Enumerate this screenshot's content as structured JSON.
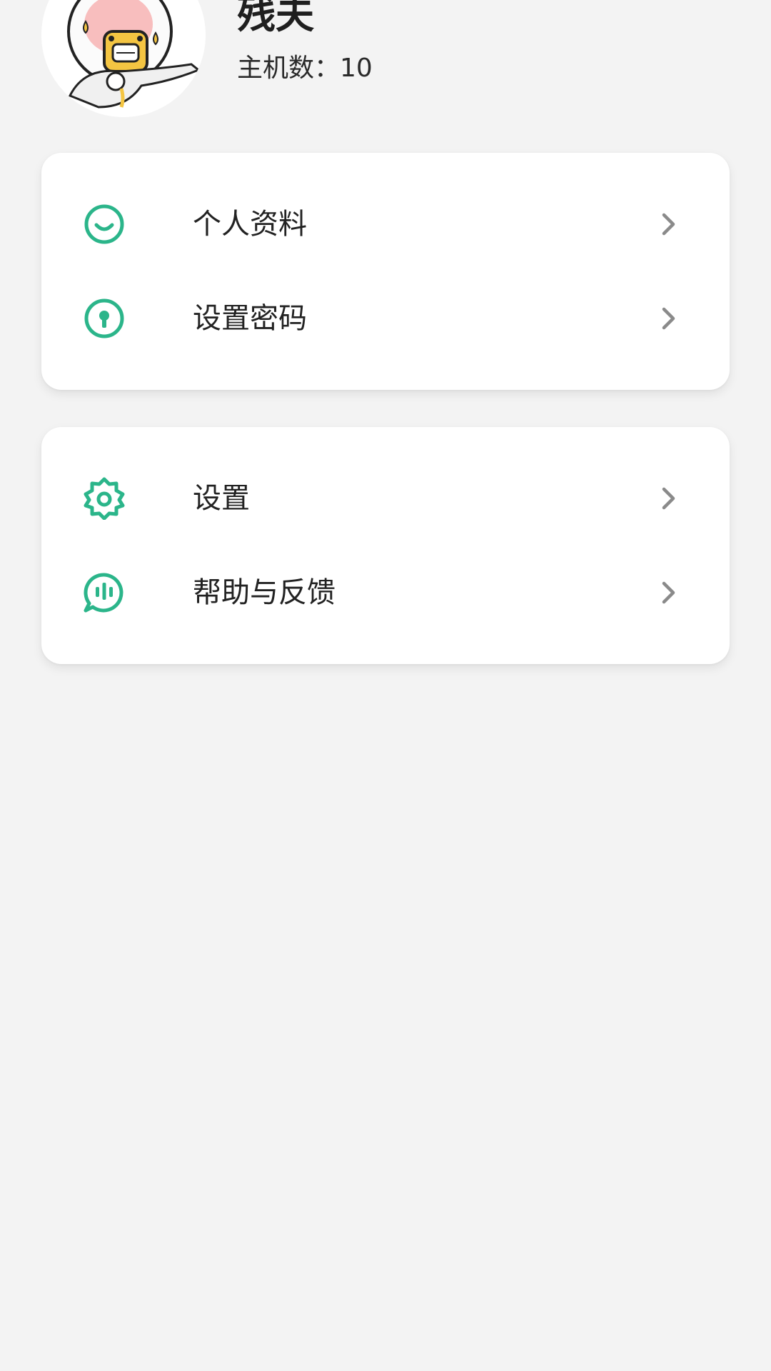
{
  "profile": {
    "username": "残夫",
    "host_count": "主机数：10"
  },
  "card_account": {
    "items": [
      {
        "label": "个人资料",
        "icon": "smile-icon"
      },
      {
        "label": "设置密码",
        "icon": "keyhole-icon"
      }
    ]
  },
  "card_app": {
    "items": [
      {
        "label": "设置",
        "icon": "gear-icon"
      },
      {
        "label": "帮助与反馈",
        "icon": "feedback-icon"
      }
    ]
  },
  "colors": {
    "accent": "#2bb58a",
    "background": "#f3f3f3",
    "card": "#ffffff",
    "chevron": "#8a8a8a"
  }
}
